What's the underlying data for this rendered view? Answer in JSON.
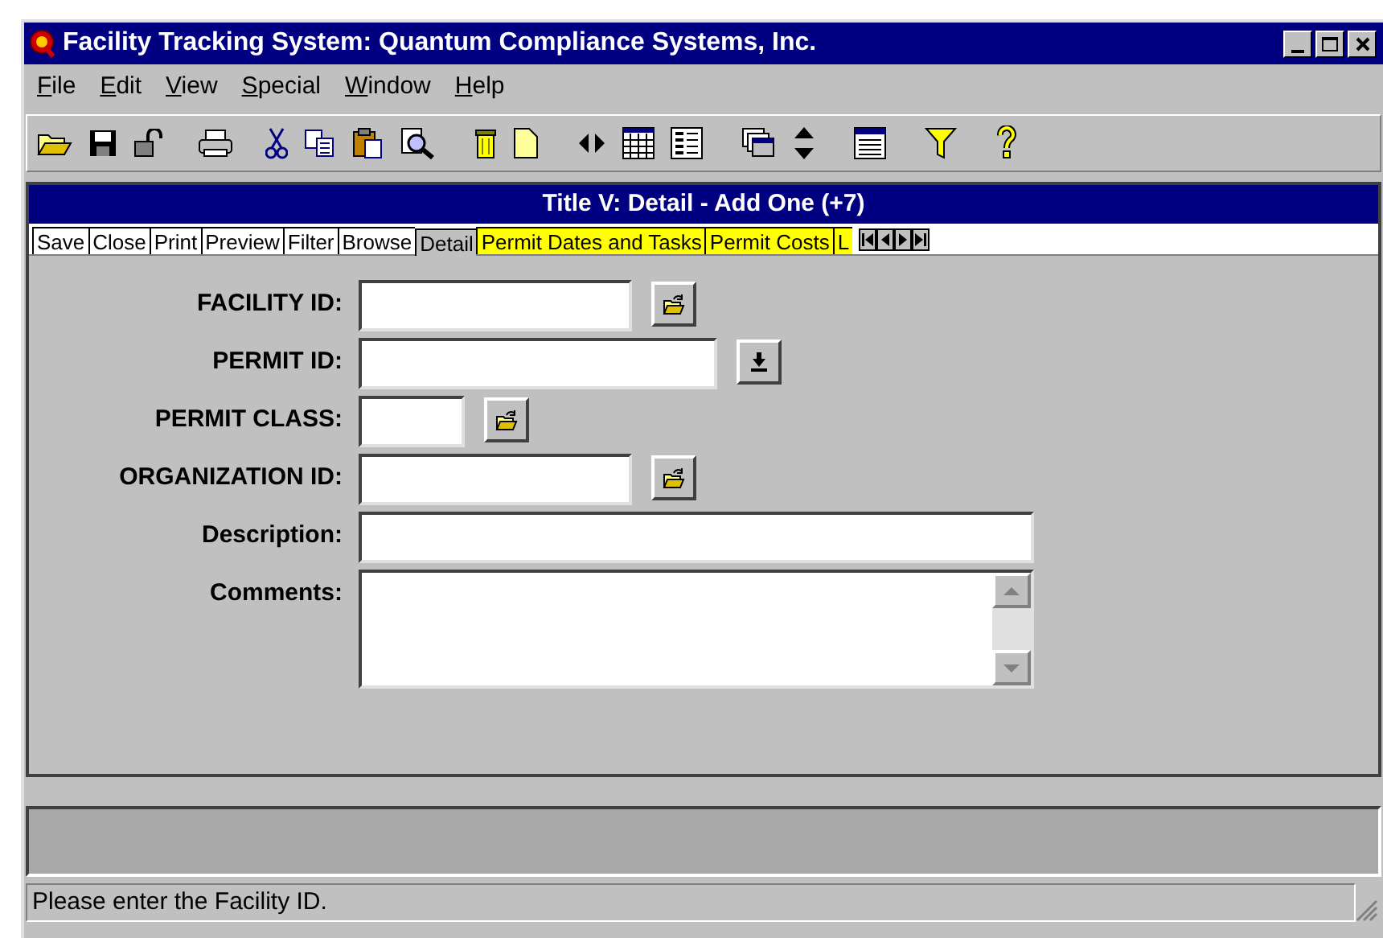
{
  "window": {
    "title": "Facility Tracking System: Quantum Compliance Systems, Inc."
  },
  "menu": [
    {
      "label": "File"
    },
    {
      "label": "Edit"
    },
    {
      "label": "View"
    },
    {
      "label": "Special"
    },
    {
      "label": "Window"
    },
    {
      "label": "Help"
    }
  ],
  "form": {
    "title": "Title V: Detail - Add One (+7)",
    "tabs": [
      {
        "label": "Save",
        "selected": false,
        "highlighted": false
      },
      {
        "label": "Close",
        "selected": false,
        "highlighted": false
      },
      {
        "label": "Print",
        "selected": false,
        "highlighted": false
      },
      {
        "label": "Preview",
        "selected": false,
        "highlighted": false
      },
      {
        "label": "Filter",
        "selected": false,
        "highlighted": false
      },
      {
        "label": "Browse",
        "selected": false,
        "highlighted": false
      },
      {
        "label": "Detail",
        "selected": true,
        "highlighted": false
      },
      {
        "label": "Permit Dates and Tasks",
        "selected": false,
        "highlighted": true
      },
      {
        "label": "Permit Costs",
        "selected": false,
        "highlighted": true
      },
      {
        "label": "L",
        "selected": false,
        "highlighted": true
      }
    ],
    "fields": [
      {
        "label": "FACILITY ID:",
        "kind": "lookup"
      },
      {
        "label": "PERMIT ID:",
        "kind": "dropdown"
      },
      {
        "label": "PERMIT CLASS:",
        "kind": "lookup"
      },
      {
        "label": "ORGANIZATION ID:",
        "kind": "lookup"
      },
      {
        "label": "Description:",
        "kind": "text"
      },
      {
        "label": "Comments:",
        "kind": "memo"
      }
    ]
  },
  "status_bar": {
    "message": "Please enter the Facility ID."
  }
}
